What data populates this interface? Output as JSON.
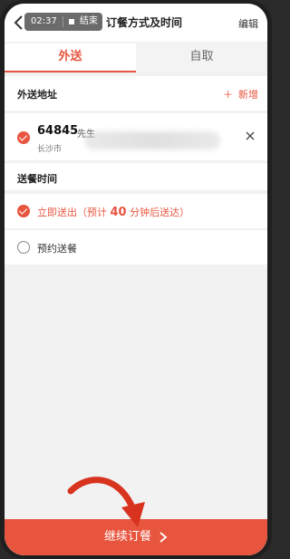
{
  "status": {
    "rec_time": "02:37",
    "rec_end": "结束"
  },
  "header": {
    "title": "订餐方式及时间",
    "edit": "编辑"
  },
  "tabs": [
    {
      "label": "外送"
    },
    {
      "label": "自取"
    }
  ],
  "address": {
    "section_label": "外送地址",
    "add_label": "新增",
    "add_icon": "plus-icon",
    "name": "64845",
    "title": "先生",
    "city": "长沙市"
  },
  "time": {
    "section_label": "送餐时间",
    "now": {
      "prefix": "立即送出（预计 ",
      "minutes": "40",
      "suffix": " 分钟后送达）"
    },
    "schedule": "预约送餐"
  },
  "continue": {
    "label": "继续订餐"
  },
  "colors": {
    "accent": "#e8553f"
  }
}
